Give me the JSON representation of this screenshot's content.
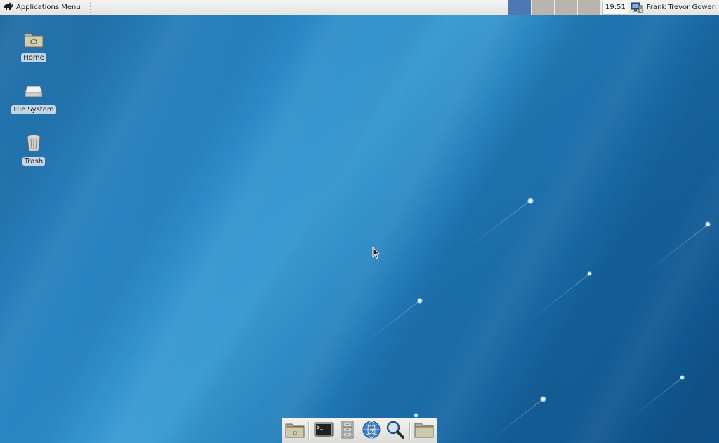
{
  "top_panel": {
    "app_menu_label": "Applications Menu",
    "workspaces": [
      {
        "name": "workspace-1",
        "active": true
      },
      {
        "name": "workspace-2",
        "active": false
      },
      {
        "name": "workspace-3",
        "active": false
      },
      {
        "name": "workspace-4",
        "active": false
      }
    ],
    "clock": "19:51",
    "user_name": "Frank Trevor Gowen"
  },
  "desktop": {
    "icons": [
      {
        "label": "Home",
        "icon": "home-folder-icon"
      },
      {
        "label": "File System",
        "icon": "drive-icon"
      },
      {
        "label": "Trash",
        "icon": "trash-icon"
      }
    ]
  },
  "dock": {
    "items": [
      {
        "icon": "home-folder-icon"
      },
      {
        "icon": "terminal-icon"
      },
      {
        "icon": "file-manager-cabinet-icon"
      },
      {
        "icon": "web-browser-icon"
      },
      {
        "icon": "search-icon"
      },
      {
        "icon": "folder-icon"
      }
    ]
  },
  "colors": {
    "panel_bg": "#e8e8e5",
    "workspace_active": "#4c79b6",
    "workspace_inactive": "#b9b4ae",
    "wallpaper_mid": "#2a86c4"
  }
}
